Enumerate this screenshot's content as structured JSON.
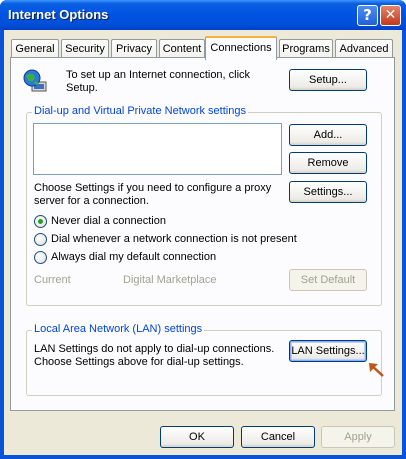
{
  "window": {
    "title": "Internet Options"
  },
  "titlebar_buttons": {
    "help": "?",
    "close": "✕"
  },
  "tabs": [
    {
      "label": "General"
    },
    {
      "label": "Security"
    },
    {
      "label": "Privacy"
    },
    {
      "label": "Content"
    },
    {
      "label": "Connections"
    },
    {
      "label": "Programs"
    },
    {
      "label": "Advanced"
    }
  ],
  "setup": {
    "text": "To set up an Internet connection, click Setup.",
    "button": "Setup..."
  },
  "dialup": {
    "title": "Dial-up and Virtual Private Network settings",
    "add": "Add...",
    "remove": "Remove",
    "settings_hint": "Choose Settings if you need to configure a proxy server for a connection.",
    "settings": "Settings...",
    "radios": [
      {
        "label": "Never dial a connection",
        "selected": true
      },
      {
        "label": "Dial whenever a network connection is not present",
        "selected": false
      },
      {
        "label": "Always dial my default connection",
        "selected": false
      }
    ],
    "current_label": "Current",
    "current_value": "Digital Marketplace",
    "set_default": "Set Default"
  },
  "lan": {
    "title": "Local Area Network (LAN) settings",
    "text": "LAN Settings do not apply to dial-up connections. Choose Settings above for dial-up settings.",
    "button": "LAN Settings..."
  },
  "footer": {
    "ok": "OK",
    "cancel": "Cancel",
    "apply": "Apply"
  },
  "colors": {
    "accent_arrow": "#c2561a",
    "group_title": "#0046d5",
    "titlebar": "#0054e3"
  }
}
